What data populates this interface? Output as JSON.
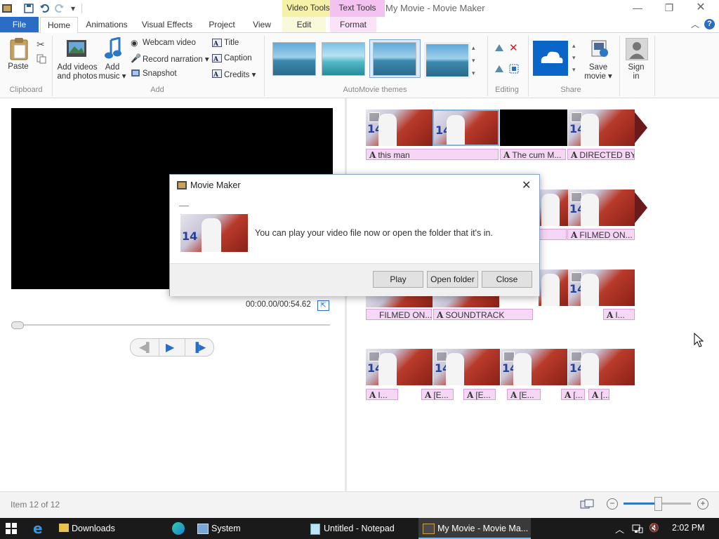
{
  "titlebar": {
    "window_title": "My Movie - Movie Maker",
    "context_tabs": {
      "video_tools": "Video Tools",
      "text_tools": "Text Tools"
    }
  },
  "tabs": {
    "file": "File",
    "home": "Home",
    "animations": "Animations",
    "visual_effects": "Visual Effects",
    "project": "Project",
    "view": "View",
    "edit": "Edit",
    "format": "Format"
  },
  "ribbon": {
    "clipboard": {
      "paste": "Paste",
      "group": "Clipboard"
    },
    "add": {
      "add_videos_line1": "Add videos",
      "add_videos_line2": "and photos",
      "add_music_line1": "Add",
      "add_music_line2": "music",
      "webcam": "Webcam video",
      "narration": "Record narration",
      "snapshot": "Snapshot",
      "title": "Title",
      "caption": "Caption",
      "credits": "Credits",
      "group": "Add"
    },
    "themes": {
      "group": "AutoMovie themes"
    },
    "editing": {
      "group": "Editing"
    },
    "share": {
      "save_line1": "Save",
      "save_line2": "movie",
      "group": "Share"
    },
    "signin": {
      "line1": "Sign",
      "line2": "in"
    }
  },
  "preview": {
    "time": "00:00.00/00:54.62"
  },
  "storyboard": {
    "row1": [
      "this man",
      "The cum M...",
      "DIRECTED BY"
    ],
    "row2": [
      "FILMED ON..."
    ],
    "row3": [
      "FILMED ON...",
      "SOUNDTRACK",
      "I..."
    ],
    "row4": [
      "I...",
      "[E...",
      "[E...",
      "[E...",
      "[...",
      "[..."
    ]
  },
  "dialog": {
    "title": "Movie Maker",
    "message": "You can play your video file now or open the folder that it's in.",
    "play": "Play",
    "open_folder": "Open folder",
    "close": "Close"
  },
  "status": {
    "item": "Item 12 of 12",
    "zoom_level": 0.5
  },
  "taskbar": {
    "downloads": "Downloads",
    "system": "System",
    "notepad": "Untitled - Notepad",
    "moviemaker": "My Movie - Movie Ma...",
    "clock": "2:02 PM"
  }
}
